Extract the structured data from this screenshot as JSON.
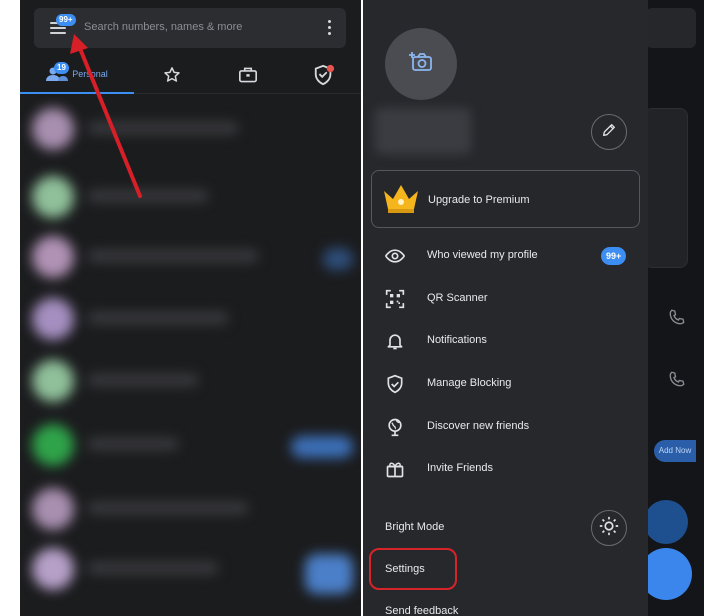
{
  "left_screen": {
    "search_placeholder": "Search numbers, names & more",
    "menu_badge": "99+",
    "tabs": [
      {
        "name": "personal",
        "label": "Personal",
        "badge": "19",
        "icon": "people-icon",
        "active": true
      },
      {
        "name": "favorites",
        "icon": "star-icon"
      },
      {
        "name": "business",
        "icon": "briefcase-icon"
      },
      {
        "name": "spam",
        "icon": "shield-icon",
        "has_dot": true
      }
    ]
  },
  "drawer": {
    "upgrade": {
      "label": "Upgrade to Premium",
      "icon": "crown-icon"
    },
    "menu_items": [
      {
        "name": "who-viewed",
        "label": "Who viewed my profile",
        "icon": "eye-icon",
        "badge": "99+"
      },
      {
        "name": "qr-scanner",
        "label": "QR Scanner",
        "icon": "qr-scanner-icon"
      },
      {
        "name": "notifications",
        "label": "Notifications",
        "icon": "bell-icon"
      },
      {
        "name": "manage-blocking",
        "label": "Manage Blocking",
        "icon": "shield-check-icon"
      },
      {
        "name": "discover-friends",
        "label": "Discover new friends",
        "icon": "globe-icon"
      },
      {
        "name": "invite-friends",
        "label": "Invite Friends",
        "icon": "gift-icon"
      }
    ],
    "bright_mode": {
      "label": "Bright Mode",
      "icon": "sun-icon"
    },
    "settings": {
      "label": "Settings"
    },
    "send_feedback": {
      "label": "Send feedback"
    }
  },
  "background_screen": {
    "add_now_label": "Add Now"
  },
  "colors": {
    "accent_blue": "#3d8ef2",
    "highlight_red": "#d6242b",
    "drawer_bg": "#27282c",
    "app_bg": "#1b1c1e"
  }
}
